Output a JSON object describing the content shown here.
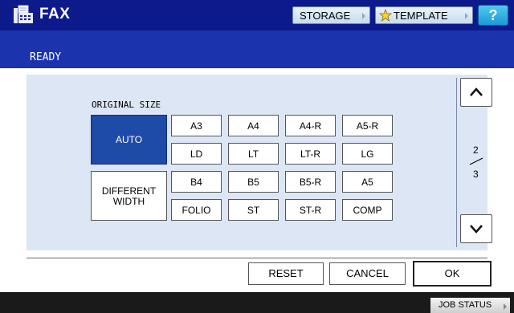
{
  "header": {
    "app_icon": "fax-machine-icon",
    "title": "FAX",
    "storage_label": "STORAGE",
    "template_label": "TEMPLATE",
    "template_icon": "star-icon",
    "help_label": "?"
  },
  "status": {
    "text": "READY"
  },
  "original_size": {
    "label": "ORIGINAL SIZE",
    "auto_label": "AUTO",
    "different_width_label": "DIFFERENT\nWIDTH",
    "selected": "AUTO",
    "sizes": [
      "A3",
      "A4",
      "A4-R",
      "A5-R",
      "LD",
      "LT",
      "LT-R",
      "LG",
      "B4",
      "B5",
      "B5-R",
      "A5",
      "FOLIO",
      "ST",
      "ST-R",
      "COMP"
    ]
  },
  "pager": {
    "current": "2",
    "total": "3",
    "up_icon": "chevron-up-icon",
    "down_icon": "chevron-down-icon"
  },
  "actions": {
    "reset_label": "RESET",
    "cancel_label": "CANCEL",
    "ok_label": "OK"
  },
  "footer": {
    "job_status_label": "JOB STATUS"
  },
  "colors": {
    "header_bg": "#0d1a8c",
    "status_bg": "#1b34ad",
    "panel_bg": "#dde6f4",
    "selected_bg": "#1e4aa8",
    "help_bg": "#1b9ad8"
  }
}
